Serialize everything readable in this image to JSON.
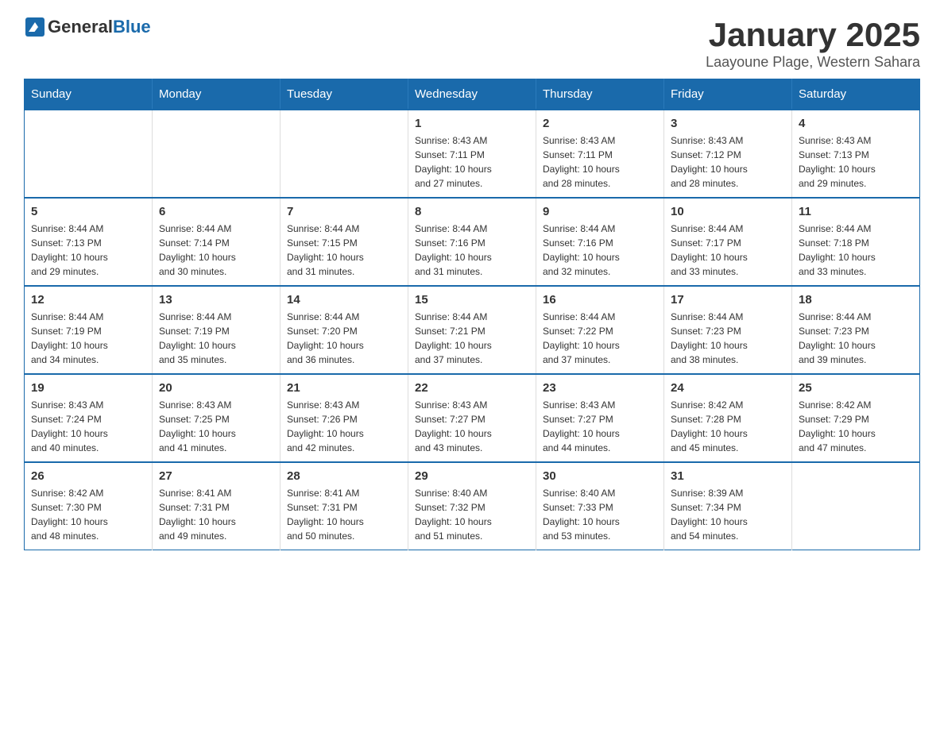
{
  "header": {
    "logo_general": "General",
    "logo_blue": "Blue",
    "title": "January 2025",
    "subtitle": "Laayoune Plage, Western Sahara"
  },
  "calendar": {
    "days_of_week": [
      "Sunday",
      "Monday",
      "Tuesday",
      "Wednesday",
      "Thursday",
      "Friday",
      "Saturday"
    ],
    "weeks": [
      [
        {
          "day": "",
          "info": ""
        },
        {
          "day": "",
          "info": ""
        },
        {
          "day": "",
          "info": ""
        },
        {
          "day": "1",
          "info": "Sunrise: 8:43 AM\nSunset: 7:11 PM\nDaylight: 10 hours\nand 27 minutes."
        },
        {
          "day": "2",
          "info": "Sunrise: 8:43 AM\nSunset: 7:11 PM\nDaylight: 10 hours\nand 28 minutes."
        },
        {
          "day": "3",
          "info": "Sunrise: 8:43 AM\nSunset: 7:12 PM\nDaylight: 10 hours\nand 28 minutes."
        },
        {
          "day": "4",
          "info": "Sunrise: 8:43 AM\nSunset: 7:13 PM\nDaylight: 10 hours\nand 29 minutes."
        }
      ],
      [
        {
          "day": "5",
          "info": "Sunrise: 8:44 AM\nSunset: 7:13 PM\nDaylight: 10 hours\nand 29 minutes."
        },
        {
          "day": "6",
          "info": "Sunrise: 8:44 AM\nSunset: 7:14 PM\nDaylight: 10 hours\nand 30 minutes."
        },
        {
          "day": "7",
          "info": "Sunrise: 8:44 AM\nSunset: 7:15 PM\nDaylight: 10 hours\nand 31 minutes."
        },
        {
          "day": "8",
          "info": "Sunrise: 8:44 AM\nSunset: 7:16 PM\nDaylight: 10 hours\nand 31 minutes."
        },
        {
          "day": "9",
          "info": "Sunrise: 8:44 AM\nSunset: 7:16 PM\nDaylight: 10 hours\nand 32 minutes."
        },
        {
          "day": "10",
          "info": "Sunrise: 8:44 AM\nSunset: 7:17 PM\nDaylight: 10 hours\nand 33 minutes."
        },
        {
          "day": "11",
          "info": "Sunrise: 8:44 AM\nSunset: 7:18 PM\nDaylight: 10 hours\nand 33 minutes."
        }
      ],
      [
        {
          "day": "12",
          "info": "Sunrise: 8:44 AM\nSunset: 7:19 PM\nDaylight: 10 hours\nand 34 minutes."
        },
        {
          "day": "13",
          "info": "Sunrise: 8:44 AM\nSunset: 7:19 PM\nDaylight: 10 hours\nand 35 minutes."
        },
        {
          "day": "14",
          "info": "Sunrise: 8:44 AM\nSunset: 7:20 PM\nDaylight: 10 hours\nand 36 minutes."
        },
        {
          "day": "15",
          "info": "Sunrise: 8:44 AM\nSunset: 7:21 PM\nDaylight: 10 hours\nand 37 minutes."
        },
        {
          "day": "16",
          "info": "Sunrise: 8:44 AM\nSunset: 7:22 PM\nDaylight: 10 hours\nand 37 minutes."
        },
        {
          "day": "17",
          "info": "Sunrise: 8:44 AM\nSunset: 7:23 PM\nDaylight: 10 hours\nand 38 minutes."
        },
        {
          "day": "18",
          "info": "Sunrise: 8:44 AM\nSunset: 7:23 PM\nDaylight: 10 hours\nand 39 minutes."
        }
      ],
      [
        {
          "day": "19",
          "info": "Sunrise: 8:43 AM\nSunset: 7:24 PM\nDaylight: 10 hours\nand 40 minutes."
        },
        {
          "day": "20",
          "info": "Sunrise: 8:43 AM\nSunset: 7:25 PM\nDaylight: 10 hours\nand 41 minutes."
        },
        {
          "day": "21",
          "info": "Sunrise: 8:43 AM\nSunset: 7:26 PM\nDaylight: 10 hours\nand 42 minutes."
        },
        {
          "day": "22",
          "info": "Sunrise: 8:43 AM\nSunset: 7:27 PM\nDaylight: 10 hours\nand 43 minutes."
        },
        {
          "day": "23",
          "info": "Sunrise: 8:43 AM\nSunset: 7:27 PM\nDaylight: 10 hours\nand 44 minutes."
        },
        {
          "day": "24",
          "info": "Sunrise: 8:42 AM\nSunset: 7:28 PM\nDaylight: 10 hours\nand 45 minutes."
        },
        {
          "day": "25",
          "info": "Sunrise: 8:42 AM\nSunset: 7:29 PM\nDaylight: 10 hours\nand 47 minutes."
        }
      ],
      [
        {
          "day": "26",
          "info": "Sunrise: 8:42 AM\nSunset: 7:30 PM\nDaylight: 10 hours\nand 48 minutes."
        },
        {
          "day": "27",
          "info": "Sunrise: 8:41 AM\nSunset: 7:31 PM\nDaylight: 10 hours\nand 49 minutes."
        },
        {
          "day": "28",
          "info": "Sunrise: 8:41 AM\nSunset: 7:31 PM\nDaylight: 10 hours\nand 50 minutes."
        },
        {
          "day": "29",
          "info": "Sunrise: 8:40 AM\nSunset: 7:32 PM\nDaylight: 10 hours\nand 51 minutes."
        },
        {
          "day": "30",
          "info": "Sunrise: 8:40 AM\nSunset: 7:33 PM\nDaylight: 10 hours\nand 53 minutes."
        },
        {
          "day": "31",
          "info": "Sunrise: 8:39 AM\nSunset: 7:34 PM\nDaylight: 10 hours\nand 54 minutes."
        },
        {
          "day": "",
          "info": ""
        }
      ]
    ]
  }
}
